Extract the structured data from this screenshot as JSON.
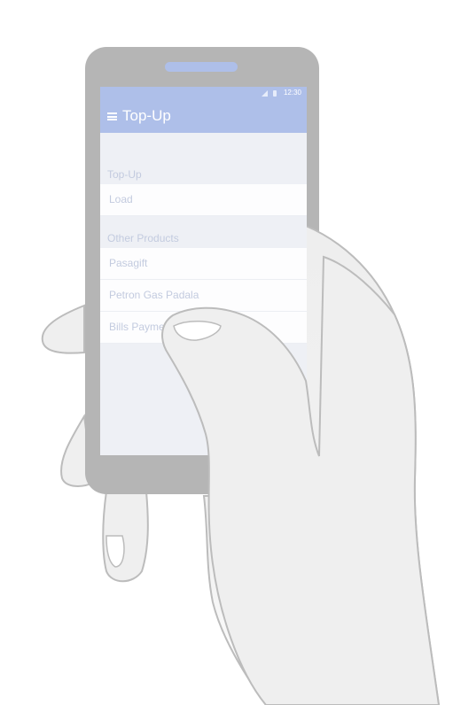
{
  "status_bar": {
    "time": "12:30"
  },
  "app_bar": {
    "title": "Top-Up",
    "menu_icon": "hamburger-menu-icon"
  },
  "sections": [
    {
      "header": "Top-Up",
      "items": [
        "Load"
      ]
    },
    {
      "header": "Other Products",
      "items": [
        "Pasagift",
        "Petron Gas Padala",
        "Bills Payment"
      ]
    }
  ],
  "colors": {
    "app_bar": "#aebfe9",
    "screen_bg": "#eef0f5",
    "row_bg": "#fdfdfe",
    "muted_text": "#c3cbdf",
    "phone_body": "#b5b5b5",
    "hand_fill": "#f1f2f2"
  }
}
